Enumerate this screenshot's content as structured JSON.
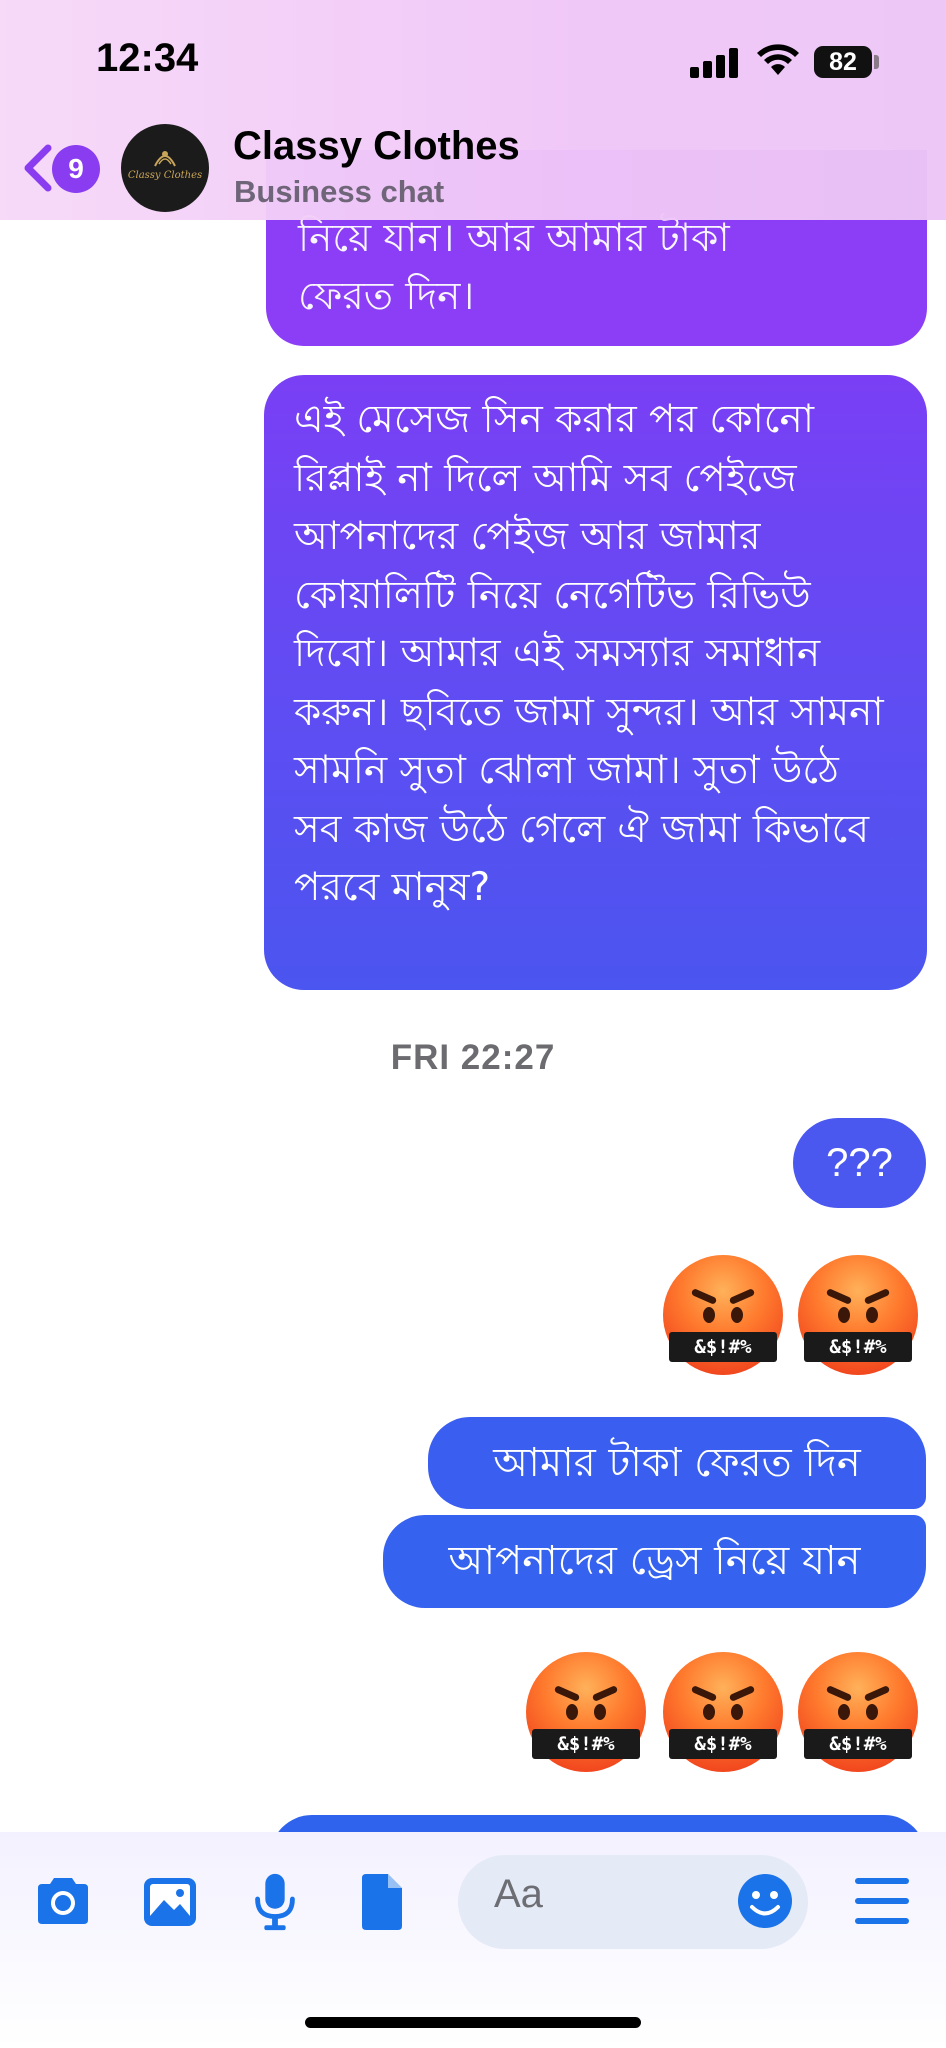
{
  "status_bar": {
    "time": "12:34",
    "battery": "82"
  },
  "header": {
    "back_badge": "9",
    "avatar_text": "Classy Clothes",
    "title": "Classy Clothes",
    "subtitle": "Business chat"
  },
  "messages": {
    "top_partial_line1": "নিয়ে যান। আর আমার টাকা",
    "top_partial_line2": "ফেরত দিন।",
    "long_message": "এই মেসেজ সিন করার পর কোনো রিপ্লাই না দিলে আমি সব পেইজে আপনাদের পেইজ আর জামার কোয়ালিটি নিয়ে নেগেটিভ রিভিউ দিবো। আমার এই সমস্যার সমাধান করুন। ছবিতে জামা সুন্দর। আর সামনা সামনি সুতা ঝোলা জামা। সুতা উঠে সব কাজ উঠে গেলে ঐ জামা কিভাবে পরবে মানুষ?",
    "timestamp": "FRI 22:27",
    "question_marks": "???",
    "money_back": "আমার টাকা ফেরত দিন",
    "take_dress": "আপনাদের ড্রেস নিয়ে যান",
    "emoji_symbols": "&$!#%"
  },
  "composer": {
    "placeholder": "Aa"
  },
  "colors": {
    "accent": "#1a73e8",
    "purple_bubble": "#8b3ef5",
    "blue_bubble": "#3a5ef0"
  },
  "icons": [
    "camera-icon",
    "image-icon",
    "microphone-icon",
    "file-icon",
    "smiley-icon",
    "menu-icon",
    "back-chevron-icon"
  ]
}
